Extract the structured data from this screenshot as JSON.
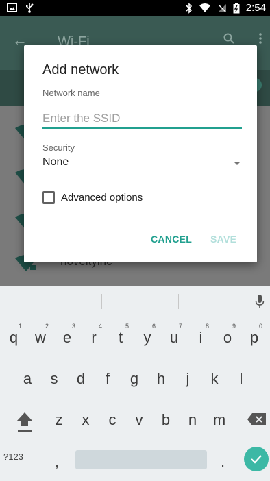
{
  "status_bar": {
    "time": "2:54",
    "icons": [
      "image-icon",
      "usb-icon",
      "bluetooth-icon",
      "wifi-signal-icon",
      "cell-signal-icon",
      "battery-icon"
    ]
  },
  "app_bar": {
    "title": "Wi-Fi"
  },
  "background_list": {
    "items": [
      {
        "label": ""
      },
      {
        "label": ""
      },
      {
        "label": ""
      },
      {
        "label": "noveltyinc"
      }
    ]
  },
  "dialog": {
    "title": "Add network",
    "network_name_label": "Network name",
    "ssid_placeholder": "Enter the SSID",
    "ssid_value": "",
    "security_label": "Security",
    "security_value": "None",
    "advanced_label": "Advanced options",
    "cancel_label": "CANCEL",
    "save_label": "SAVE"
  },
  "keyboard": {
    "row1": [
      {
        "key": "q",
        "hint": "1"
      },
      {
        "key": "w",
        "hint": "2"
      },
      {
        "key": "e",
        "hint": "3"
      },
      {
        "key": "r",
        "hint": "4"
      },
      {
        "key": "t",
        "hint": "5"
      },
      {
        "key": "y",
        "hint": "6"
      },
      {
        "key": "u",
        "hint": "7"
      },
      {
        "key": "i",
        "hint": "8"
      },
      {
        "key": "o",
        "hint": "9"
      },
      {
        "key": "p",
        "hint": "0"
      }
    ],
    "row2": [
      "a",
      "s",
      "d",
      "f",
      "g",
      "h",
      "j",
      "k",
      "l"
    ],
    "row3": [
      "z",
      "x",
      "c",
      "v",
      "b",
      "n",
      "m"
    ],
    "symbols_label": "?123",
    "comma": ",",
    "period": "."
  },
  "colors": {
    "accent": "#21a08f",
    "save_disabled": "#b2dfdb",
    "enter_key": "#3cb8a5"
  }
}
